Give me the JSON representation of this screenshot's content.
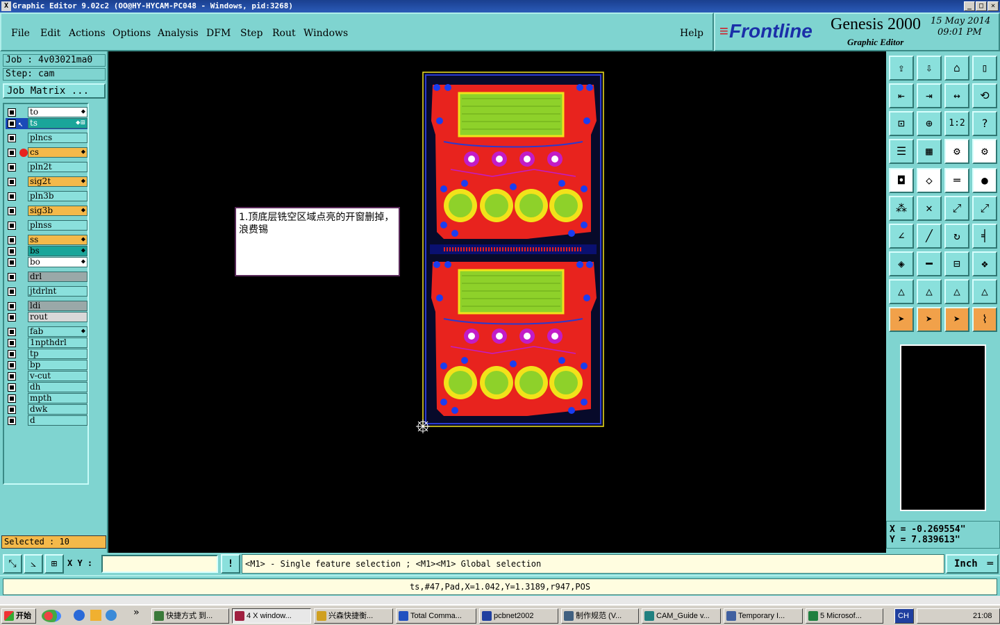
{
  "window": {
    "title": "Graphic Editor 9.02c2 (OO@HY-HYCAM-PC048 - Windows, pid:3268)",
    "buttons": [
      "_",
      "□",
      "✕"
    ]
  },
  "menu": {
    "items": [
      "File",
      "Edit",
      "Actions",
      "Options",
      "Analysis",
      "DFM",
      "Step",
      "Rout",
      "Windows"
    ],
    "help": "Help"
  },
  "brand": {
    "logo": "Frontline",
    "product": "Genesis 2000",
    "subtitle": "Graphic Editor",
    "date": "15 May 2014",
    "time": "09:01 PM"
  },
  "job": {
    "job_line": "Job : 4v03021ma0",
    "step_line": "Step: cam",
    "matrix_button": "Job Matrix ..."
  },
  "layers": [
    {
      "name": "to",
      "color": "#ffffff",
      "mark": "⬥"
    },
    {
      "name": "ts",
      "color": "#1aa59a",
      "mark": "⬥⊞",
      "active": true
    },
    {
      "name": "plncs",
      "color": "#8ae0dc",
      "mark": ""
    },
    {
      "name": "cs",
      "color": "#f4b94a",
      "mark": "⬥",
      "dot": "#e8231e"
    },
    {
      "name": "pln2t",
      "color": "#8ae0dc",
      "mark": ""
    },
    {
      "name": "sig2t",
      "color": "#f4b94a",
      "mark": "⬥"
    },
    {
      "name": "pln3b",
      "color": "#8ae0dc",
      "mark": ""
    },
    {
      "name": "sig3b",
      "color": "#f4b94a",
      "mark": "⬥"
    },
    {
      "name": "plnss",
      "color": "#8ae0dc",
      "mark": ""
    },
    {
      "name": "ss",
      "color": "#f4b94a",
      "mark": "⬥"
    },
    {
      "name": "bs",
      "color": "#1aa59a",
      "mark": "⬥"
    },
    {
      "name": "bo",
      "color": "#ffffff",
      "mark": "⬥"
    },
    {
      "name": "drl",
      "color": "#9aa8a8",
      "mark": ""
    },
    {
      "name": "jtdrlnt",
      "color": "#8ae0dc",
      "mark": ""
    },
    {
      "name": "ldi",
      "color": "#9aa8a8",
      "mark": ""
    },
    {
      "name": "rout",
      "color": "#d8d8d8",
      "mark": ""
    },
    {
      "name": "fab",
      "color": "#8ae0dc",
      "mark": "⬥"
    },
    {
      "name": "1npthdrl",
      "color": "#8ae0dc",
      "mark": ""
    },
    {
      "name": "tp",
      "color": "#8ae0dc",
      "mark": ""
    },
    {
      "name": "bp",
      "color": "#8ae0dc",
      "mark": ""
    },
    {
      "name": "v-cut",
      "color": "#8ae0dc",
      "mark": ""
    },
    {
      "name": "dh",
      "color": "#8ae0dc",
      "mark": ""
    },
    {
      "name": "mpth",
      "color": "#8ae0dc",
      "mark": ""
    },
    {
      "name": "dwk",
      "color": "#8ae0dc",
      "mark": ""
    },
    {
      "name": "d",
      "color": "#8ae0dc",
      "mark": ""
    }
  ],
  "selected": "Selected : 10",
  "note": "1.顶底层铣空区域点亮的开窗删掉，浪费锡",
  "coords": {
    "x": "X = -0.269554\"",
    "y": "Y = 7.839613\""
  },
  "bottom": {
    "xy_label": "X Y :",
    "xy_value": "",
    "hint": "<M1> - Single feature selection ; <M1><M1> Global selection",
    "unit": "Inch"
  },
  "status": "ts,#47,Pad,X=1.042,Y=1.3189,r947,POS",
  "taskbar": {
    "start": "开始",
    "items": [
      "快捷方式 到...",
      "4 X window...",
      "兴森快捷衡...",
      "Total Comma...",
      "pcbnet2002",
      "制作规范 (V...",
      "CAM_Guide v...",
      "Temporary I...",
      "5 Microsof..."
    ],
    "lang": "CH",
    "clock": "21:08"
  },
  "colors": {
    "panel": "#7fd4d0",
    "board_copper": "#e8231e",
    "pad_yellow": "#f2e21a",
    "pad_green": "#8ed12a",
    "via_magenta": "#c21cc7",
    "via_blue": "#1b3df0"
  },
  "toolbar_icons": [
    "open-job-icon",
    "save-icon",
    "home-icon",
    "panel-icon",
    "prev-step-icon",
    "next-step-icon",
    "swap-icon",
    "rotate-icon",
    "zoom-fit-icon",
    "zoom-window-icon",
    "zoom-1to1-icon",
    "help-icon",
    "tools-icon",
    "grid-icon",
    "layer-pair-icon",
    "layer-compare-icon",
    "snap-center-icon",
    "snap-edge-icon",
    "ruler-icon",
    "snap-pad-icon",
    "net-icon",
    "cross-icon",
    "point-to-point-icon",
    "point-snap-icon",
    "angle-icon",
    "line-icon",
    "arc-icon",
    "mirror-icon",
    "select-icon",
    "separate-icon",
    "measure-icon",
    "group-icon",
    "triangle-a-icon",
    "triangle-b-icon",
    "triangle-c-icon",
    "triangle-d-icon",
    "pointer-icon",
    "pointer-box-icon",
    "pointer-touch-icon",
    "route-icon"
  ]
}
